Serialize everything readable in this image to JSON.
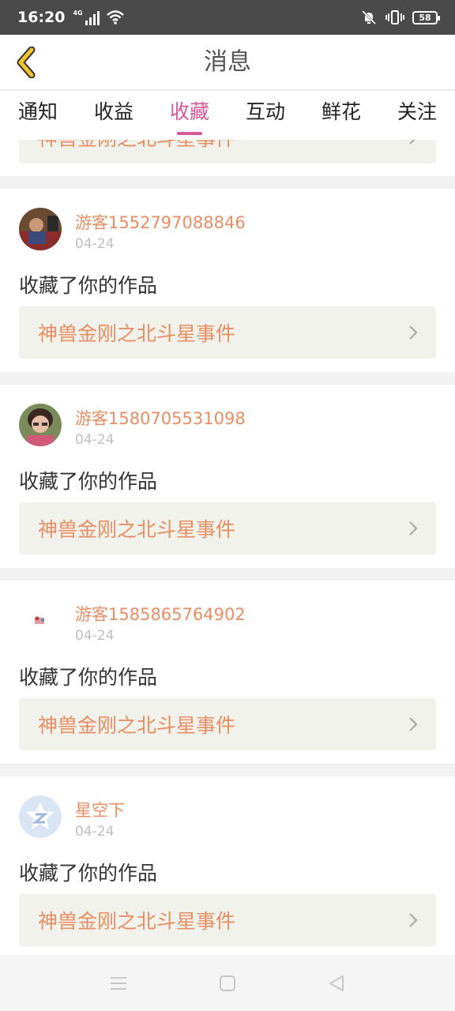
{
  "status_bar": {
    "time": "16:20",
    "network": "4G",
    "battery": "58"
  },
  "header": {
    "title": "消息"
  },
  "tabs": [
    {
      "label": "通知",
      "active": false
    },
    {
      "label": "收益",
      "active": false
    },
    {
      "label": "收藏",
      "active": true
    },
    {
      "label": "互动",
      "active": false
    },
    {
      "label": "鲜花",
      "active": false
    },
    {
      "label": "关注",
      "active": false
    }
  ],
  "partial_card": {
    "work_title": "神兽金刚之北斗星事件"
  },
  "messages": [
    {
      "username": "游客1552797088846",
      "date": "04-24",
      "text": "收藏了你的作品",
      "work_title": "神兽金刚之北斗星事件"
    },
    {
      "username": "游客1580705531098",
      "date": "04-24",
      "text": "收藏了你的作品",
      "work_title": "神兽金刚之北斗星事件"
    },
    {
      "username": "游客1585865764902",
      "date": "04-24",
      "text": "收藏了你的作品",
      "work_title": "神兽金刚之北斗星事件"
    },
    {
      "username": "星空下",
      "date": "04-24",
      "text": "收藏了你的作品",
      "work_title": "神兽金刚之北斗星事件"
    }
  ],
  "colors": {
    "accent": "#d9579a",
    "username": "#e88e63",
    "back_icon": "#f2c32c",
    "status_bar": "#4a4a4a"
  }
}
